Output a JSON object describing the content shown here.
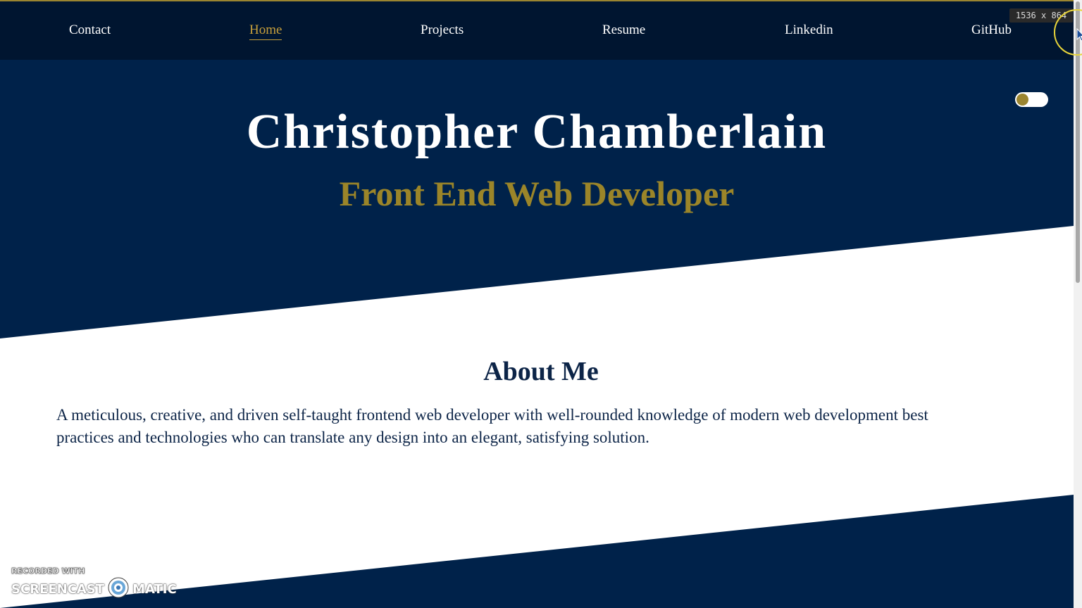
{
  "nav": {
    "items": [
      {
        "label": "Contact",
        "active": false
      },
      {
        "label": "Home",
        "active": true
      },
      {
        "label": "Projects",
        "active": false
      },
      {
        "label": "Resume",
        "active": false
      },
      {
        "label": "Linkedin",
        "active": false
      },
      {
        "label": "GitHub",
        "active": false
      }
    ]
  },
  "hero": {
    "name": "Christopher Chamberlain",
    "role": "Front End Web Developer"
  },
  "theme_toggle": {
    "icon": "toggle-switch"
  },
  "about": {
    "title": "About Me",
    "body": "A meticulous, creative, and driven self-taught frontend web developer with well-rounded knowledge of modern web development best practices and technologies who can translate any design into an elegant, satisfying solution."
  },
  "overlay": {
    "resolution": "1536 x 864",
    "watermark_top": "RECORDED WITH",
    "watermark_left": "SCREENCAST",
    "watermark_right": "MATIC"
  },
  "colors": {
    "nav_bg": "#001530",
    "hero_bg": "#00224a",
    "accent_gold": "#9b8529",
    "active_link": "#c79f3b",
    "about_text": "#0c2447"
  }
}
